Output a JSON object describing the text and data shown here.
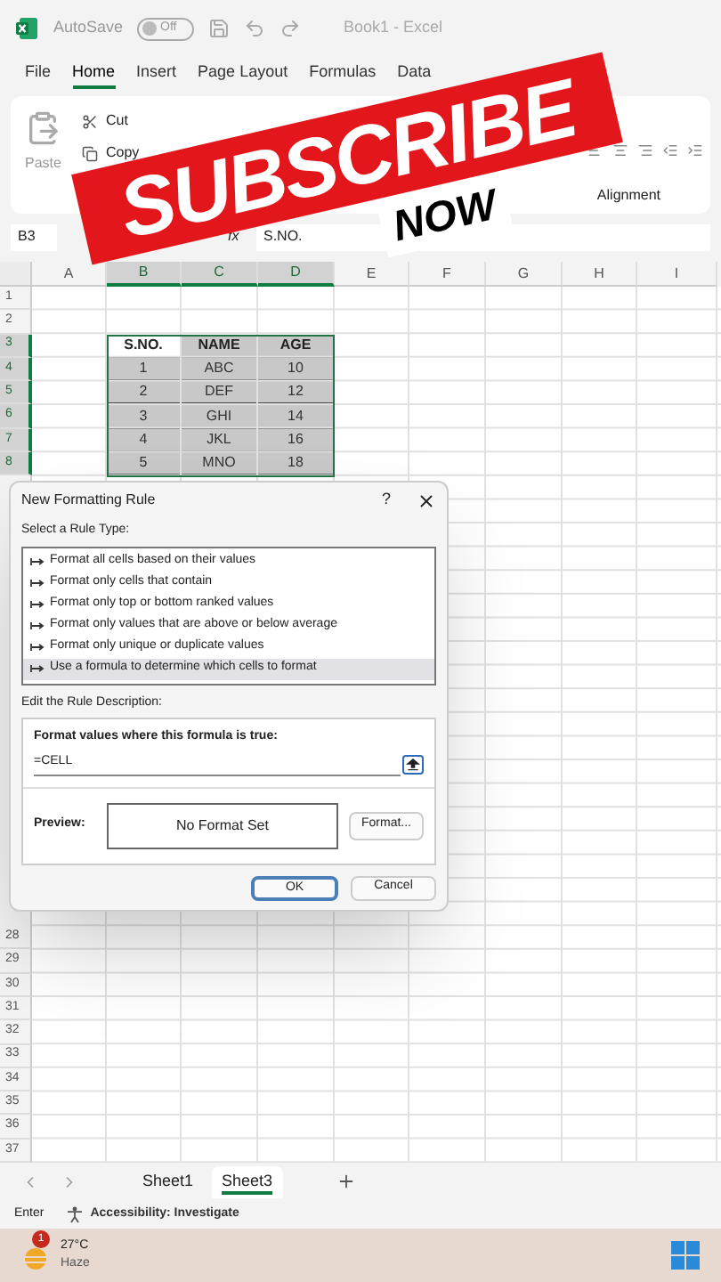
{
  "title_bar": {
    "autosave_label": "AutoSave",
    "autosave": {
      "text": "Off",
      "on": false
    },
    "title": "Book1 - Excel"
  },
  "ribbon_tabs": [
    {
      "label": "File",
      "selected": false
    },
    {
      "label": "Home",
      "selected": true
    },
    {
      "label": "Insert",
      "selected": false
    },
    {
      "label": "Page Layout",
      "selected": false
    },
    {
      "label": "Formulas",
      "selected": false
    },
    {
      "label": "Data",
      "selected": false
    }
  ],
  "ribbon": {
    "paste": "Paste",
    "cut": "Cut",
    "copy": "Copy",
    "group_label": "Alignment"
  },
  "banner": {
    "headline": "SUBSCRIBE",
    "subline": "NOW"
  },
  "formula_bar": {
    "name_box": "B3",
    "fx": "fx",
    "formula": "S.NO."
  },
  "sheet": {
    "columns": [
      {
        "label": "A",
        "selected": false
      },
      {
        "label": "B",
        "selected": true
      },
      {
        "label": "C",
        "selected": true
      },
      {
        "label": "D",
        "selected": true
      },
      {
        "label": "E",
        "selected": false
      },
      {
        "label": "F",
        "selected": false
      },
      {
        "label": "G",
        "selected": false
      },
      {
        "label": "H",
        "selected": false
      },
      {
        "label": "I",
        "selected": false
      }
    ],
    "rows": [
      {
        "header": "1",
        "selected": false
      },
      {
        "header": "2",
        "selected": false
      },
      {
        "header": "3",
        "selected": true
      },
      {
        "header": "4",
        "selected": true
      },
      {
        "header": "5",
        "selected": true
      },
      {
        "header": "6",
        "selected": true
      },
      {
        "header": "7",
        "selected": true
      },
      {
        "header": "8",
        "selected": true
      }
    ],
    "lower_rows": [
      "28",
      "29",
      "30",
      "31",
      "32",
      "33",
      "34",
      "35",
      "36",
      "37"
    ]
  },
  "table": {
    "headers": [
      {
        "label": "S.NO.",
        "active": true
      },
      {
        "label": "NAME",
        "active": false
      },
      {
        "label": "AGE",
        "active": false
      }
    ],
    "rows": [
      [
        "1",
        "ABC",
        "10"
      ],
      [
        "2",
        "DEF",
        "12"
      ],
      [
        "3",
        "GHI",
        "14"
      ],
      [
        "4",
        "JKL",
        "16"
      ],
      [
        "5",
        "MNO",
        "18"
      ]
    ]
  },
  "dialog": {
    "title": "New Formatting Rule",
    "help": "?",
    "rule_type_label": "Select a Rule Type:",
    "rule_types": [
      {
        "label": "Format all cells based on their values",
        "selected": false
      },
      {
        "label": "Format only cells that contain",
        "selected": false
      },
      {
        "label": "Format only top or bottom ranked values",
        "selected": false
      },
      {
        "label": "Format only values that are above or below average",
        "selected": false
      },
      {
        "label": "Format only unique or duplicate values",
        "selected": false
      },
      {
        "label": "Use a formula to determine which cells to format",
        "selected": true
      }
    ],
    "description_label": "Edit the Rule Description:",
    "formula_label": "Format values where this formula is true:",
    "formula_value": "=CELL",
    "preview_label": "Preview:",
    "preview_text": "No Format Set",
    "format_button": "Format...",
    "ok": "OK",
    "cancel": "Cancel"
  },
  "sheet_tabs": [
    {
      "label": "Sheet1",
      "selected": false
    },
    {
      "label": "Sheet3",
      "selected": true
    }
  ],
  "status_bar": {
    "mode": "Enter",
    "accessibility": "Accessibility: Investigate"
  },
  "taskbar": {
    "badge": "1",
    "temperature": "27°C",
    "condition": "Haze"
  }
}
